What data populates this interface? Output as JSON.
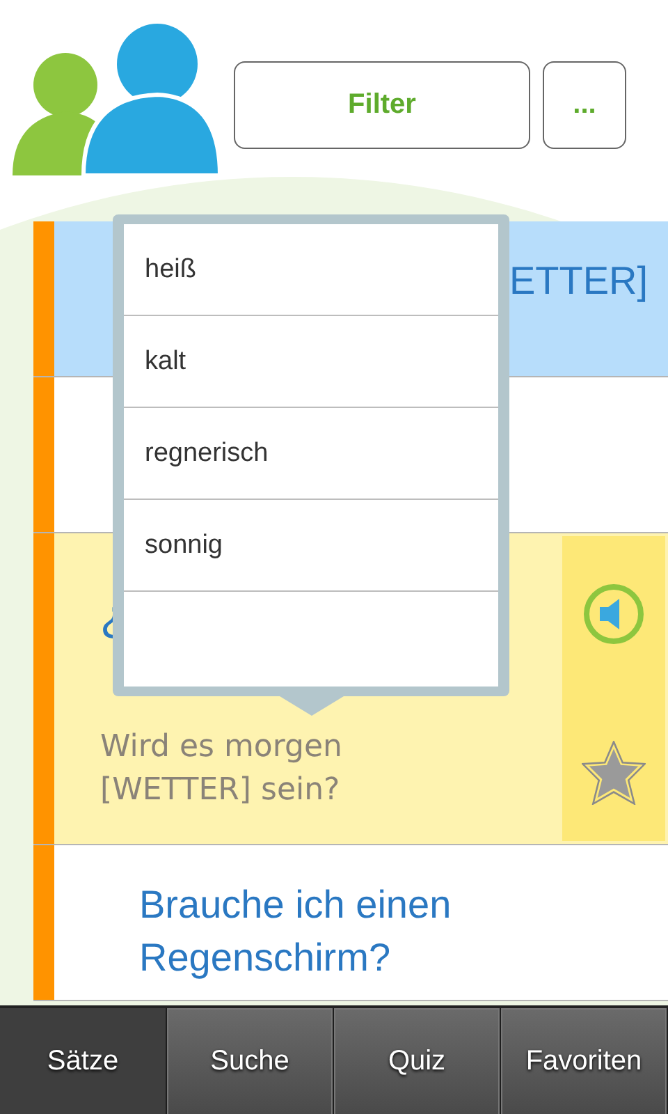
{
  "header": {
    "filter_button": "Filter",
    "more_button": "..."
  },
  "sentences": [
    {
      "title": "ETTER]",
      "selected": true,
      "expanded": false
    },
    {
      "selected": false,
      "expanded": false
    },
    {
      "title": "¿",
      "translation": "Wird es morgen [WETTER] sein?",
      "selected": false,
      "expanded": true
    },
    {
      "title": "Brauche ich einen Regenschirm?",
      "selected": false,
      "expanded": false
    }
  ],
  "word_options": [
    "heiß",
    "kalt",
    "regnerisch",
    "sonnig"
  ],
  "tabs": [
    {
      "label": "Sätze",
      "selected": true
    },
    {
      "label": "Suche",
      "selected": false
    },
    {
      "label": "Quiz",
      "selected": false
    },
    {
      "label": "Favoriten",
      "selected": false
    }
  ]
}
